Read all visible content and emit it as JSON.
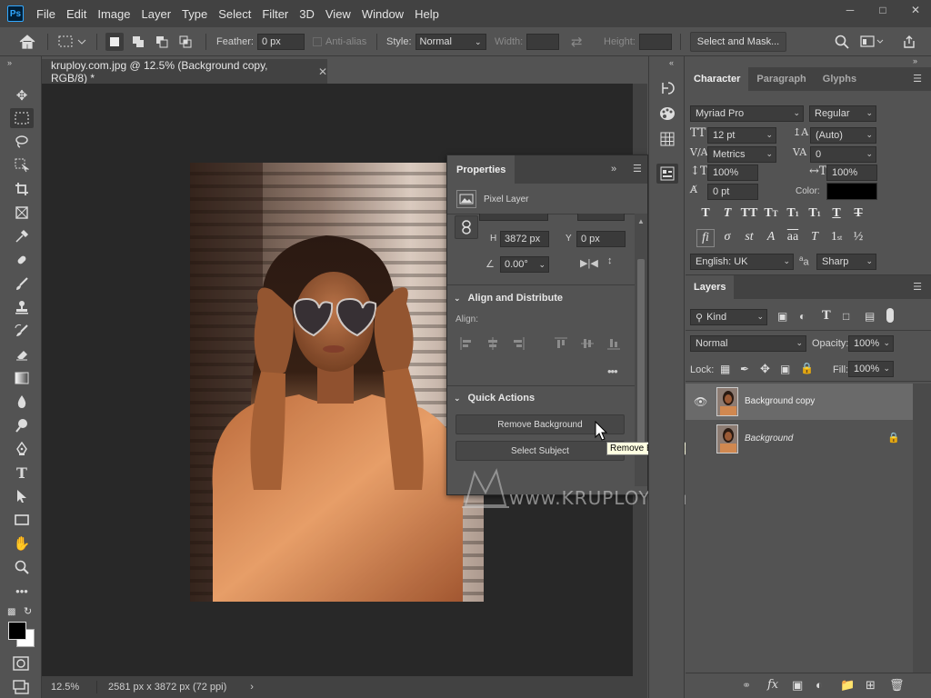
{
  "app": {
    "logo": "Ps",
    "menus": [
      "File",
      "Edit",
      "Image",
      "Layer",
      "Type",
      "Select",
      "Filter",
      "3D",
      "View",
      "Window",
      "Help"
    ]
  },
  "options_bar": {
    "feather_label": "Feather:",
    "feather_value": "0 px",
    "antialias_label": "Anti-alias",
    "style_label": "Style:",
    "style_value": "Normal",
    "width_label": "Width:",
    "height_label": "Height:",
    "select_mask_label": "Select and Mask..."
  },
  "document": {
    "tab_title": "kruploy.com.jpg @ 12.5% (Background copy, RGB/8) *",
    "zoom": "12.5%",
    "dimensions": "2581 px x 3872 px (72 ppi)"
  },
  "properties": {
    "tab": "Properties",
    "layer_type": "Pixel Layer",
    "h_label": "H",
    "h_value": "3872 px",
    "y_label": "Y",
    "y_value": "0 px",
    "angle_value": "0.00°",
    "align_section": "Align and Distribute",
    "align_label": "Align:",
    "quick_actions_section": "Quick Actions",
    "remove_bg_label": "Remove Background",
    "select_subject_label": "Select Subject"
  },
  "tooltip": "Remove Background",
  "watermark": "www.KRUPLOY.com",
  "character": {
    "tabs": [
      "Character",
      "Paragraph",
      "Glyphs"
    ],
    "font_family": "Myriad Pro",
    "font_style": "Regular",
    "font_size": "12 pt",
    "leading": "(Auto)",
    "kerning": "Metrics",
    "tracking": "0",
    "vscale": "100%",
    "hscale": "100%",
    "baseline": "0 pt",
    "color_label": "Color:",
    "language": "English: UK",
    "antialias": "Sharp",
    "aa_glyph": "aa"
  },
  "layers": {
    "tab": "Layers",
    "kind_label": "Kind",
    "blend_mode": "Normal",
    "opacity_label": "Opacity:",
    "opacity_value": "100%",
    "lock_label": "Lock:",
    "fill_label": "Fill:",
    "fill_value": "100%",
    "items": [
      {
        "name": "Background copy"
      },
      {
        "name": "Background"
      }
    ]
  },
  "colors": {
    "accent": "#31a8ff",
    "panel": "#535353",
    "dark": "#424242",
    "canvas": "#282828"
  }
}
